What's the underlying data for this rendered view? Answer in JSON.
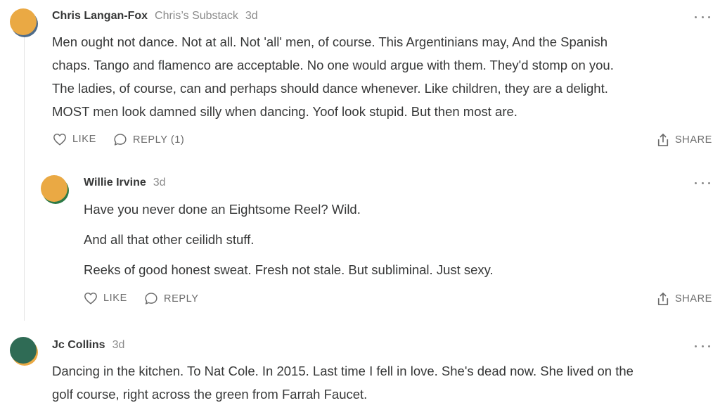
{
  "comments": [
    {
      "author": "Chris Langan-Fox",
      "publication": "Chris’s Substack",
      "time": "3d",
      "avatar_colors": {
        "front": "#eaa944",
        "back": "#4f6c8a"
      },
      "paragraphs": [
        "Men ought not dance. Not at all. Not 'all' men, of course. This Argentinians may, And the Spanish",
        "chaps. Tango and flamenco are acceptable. No one would argue with them. They'd stomp on you.",
        "The ladies, of course, can and perhaps should dance whenever. Like children, they are a delight.",
        "MOST men look damned silly when dancing. Yoof look stupid. But then most are."
      ],
      "like_label": "LIKE",
      "reply_label": "REPLY (1)",
      "share_label": "SHARE"
    },
    {
      "author": "Willie Irvine",
      "time": "3d",
      "avatar_colors": {
        "front": "#eaa944",
        "back": "#2d7a47"
      },
      "paragraphs": [
        "Have you never done an Eightsome Reel? Wild.",
        "And all that other ceilidh stuff.",
        "Reeks of good honest sweat. Fresh not stale. But subliminal. Just sexy."
      ],
      "like_label": "LIKE",
      "reply_label": "REPLY",
      "share_label": "SHARE"
    },
    {
      "author": "Jc Collins",
      "time": "3d",
      "avatar_colors": {
        "front": "#2f6b55",
        "back": "#eaa944"
      },
      "paragraphs": [
        "Dancing in the kitchen. To Nat Cole. In 2015. Last time I fell in love. She's dead now. She lived on the",
        "golf course, right across the green from Farrah Faucet."
      ]
    }
  ]
}
